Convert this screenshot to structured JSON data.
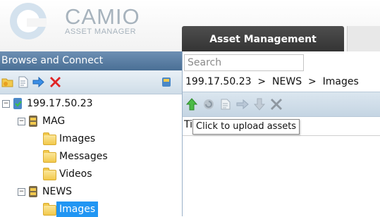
{
  "brand": {
    "name": "CAMIO",
    "subtitle": "ASSET MANAGER"
  },
  "tabs": [
    {
      "label": "Asset Management",
      "active": true
    }
  ],
  "left_panel": {
    "title": "Browse and Connect",
    "toolbar_icons": [
      "folder-icon",
      "document-icon",
      "arrow-right-icon",
      "delete-icon",
      "database-icon"
    ],
    "tree": {
      "root": "199.17.50.23",
      "nodes": [
        {
          "label": "MAG",
          "children": [
            "Images",
            "Messages",
            "Videos"
          ]
        },
        {
          "label": "NEWS",
          "children": [
            "Images"
          ]
        }
      ],
      "selected": "Images"
    }
  },
  "right_panel": {
    "search_placeholder": "Search",
    "breadcrumb": "199.17.50.23  >  NEWS  >  Images",
    "toolbar_icons": [
      "upload-arrow-icon",
      "refresh-icon",
      "copy-icon",
      "move-arrow-icon",
      "download-arrow-icon",
      "delete-icon"
    ],
    "column_header": "Ti",
    "tooltip": "Click to upload assets"
  },
  "colors": {
    "header_blue": "#5a7fa5",
    "selection": "#2196f3",
    "tab_dark": "#3f3f3f"
  }
}
